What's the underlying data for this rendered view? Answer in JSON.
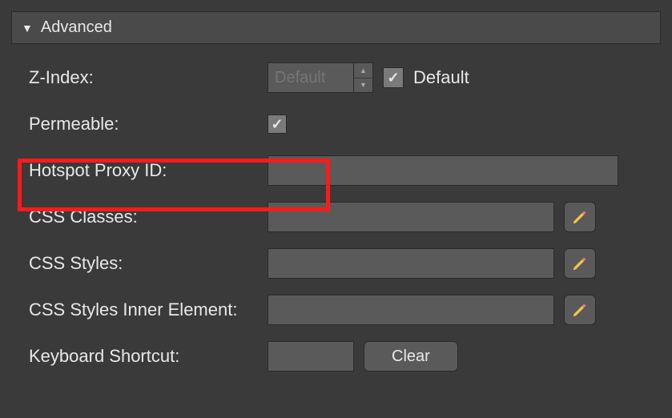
{
  "section": {
    "title": "Advanced"
  },
  "rows": {
    "zindex": {
      "label": "Z-Index:",
      "placeholder": "Default",
      "default_label": "Default"
    },
    "permeable": {
      "label": "Permeable:"
    },
    "hotspot": {
      "label": "Hotspot Proxy ID:",
      "value": ""
    },
    "cssclasses": {
      "label": "CSS Classes:",
      "value": ""
    },
    "cssstyles": {
      "label": "CSS Styles:",
      "value": ""
    },
    "cssinner": {
      "label": "CSS Styles Inner Element:",
      "value": ""
    },
    "shortcut": {
      "label": "Keyboard Shortcut:",
      "value": "",
      "clear": "Clear"
    }
  }
}
